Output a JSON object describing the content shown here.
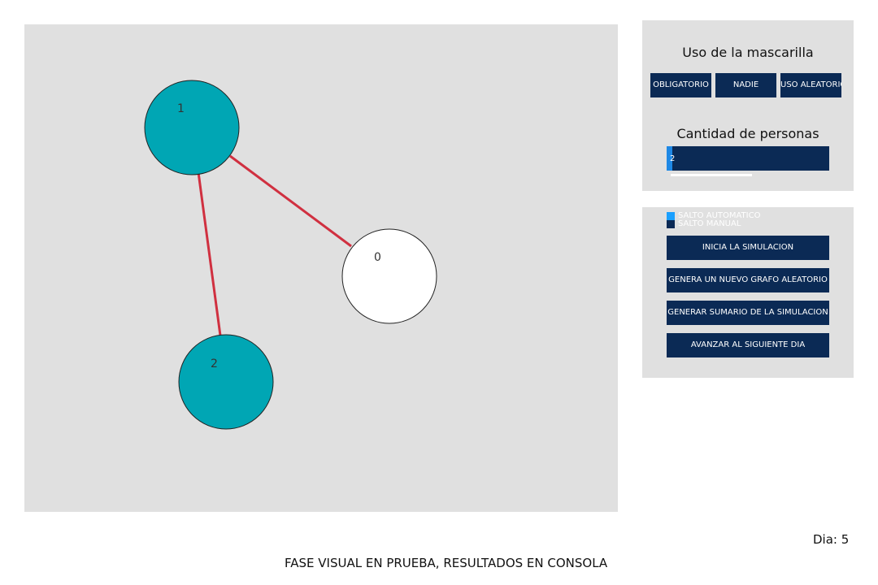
{
  "graph": {
    "nodes": [
      {
        "label": "0",
        "color": "#ffffff"
      },
      {
        "label": "1",
        "color": "#00a6b4"
      },
      {
        "label": "2",
        "color": "#00a6b4"
      }
    ],
    "edges": [
      [
        "1",
        "0"
      ],
      [
        "1",
        "2"
      ]
    ],
    "edge_color": "#d03040"
  },
  "mask_panel": {
    "title": "Uso de la mascarilla",
    "buttons": [
      "OBLIGATORIO",
      "NADIE",
      "USO ALEATORIO"
    ],
    "people_title": "Cantidad de personas",
    "people_value": "2"
  },
  "controls": {
    "radio_auto": {
      "label": "SALTO AUTOMATICO",
      "color": "#1aa0ff"
    },
    "radio_manual": {
      "label": "SALTO MANUAL",
      "color": "#0b2a55"
    },
    "start_label": "INICIA LA SIMULACION",
    "new_graph_label": "GENERA UN NUEVO GRAFO ALEATORIO",
    "summary_label": "GENERAR SUMARIO DE LA SIMULACION",
    "next_day_label": "AVANZAR AL SIGUIENTE DIA"
  },
  "status": {
    "day_label": "Dia: 5",
    "footer": "FASE VISUAL EN PRUEBA, RESULTADOS EN CONSOLA"
  }
}
